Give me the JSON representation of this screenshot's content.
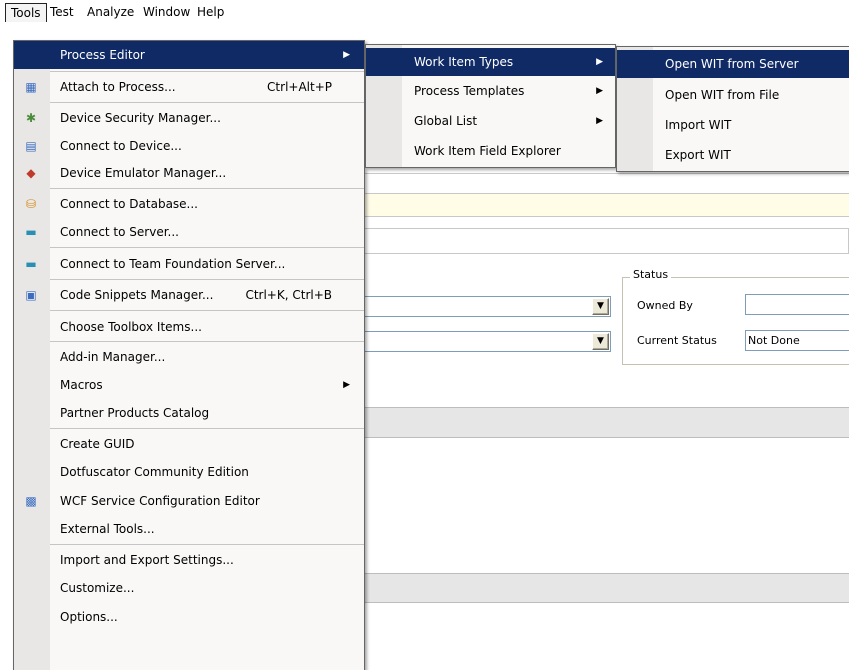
{
  "menubar": {
    "items": [
      {
        "label": "Tools"
      },
      {
        "label": "Test"
      },
      {
        "label": "Analyze"
      },
      {
        "label": "Window"
      },
      {
        "label": "Help"
      }
    ]
  },
  "tools_menu": {
    "items": [
      {
        "label": "Process Editor",
        "shortcut": "",
        "submenu": true,
        "icon": ""
      },
      {
        "label": "Attach to Process...",
        "shortcut": "Ctrl+Alt+P",
        "icon": "attach-process-icon"
      },
      {
        "label": "Device Security Manager...",
        "shortcut": "",
        "icon": "device-security-icon"
      },
      {
        "label": "Connect to Device...",
        "shortcut": "",
        "icon": "connect-device-icon"
      },
      {
        "label": "Device Emulator Manager...",
        "shortcut": "",
        "icon": "emulator-manager-icon"
      },
      {
        "label": "Connect to Database...",
        "shortcut": "",
        "icon": "database-icon"
      },
      {
        "label": "Connect to Server...",
        "shortcut": "",
        "icon": "server-icon"
      },
      {
        "label": "Connect to Team Foundation Server...",
        "shortcut": "",
        "icon": "team-server-icon"
      },
      {
        "label": "Code Snippets Manager...",
        "shortcut": "Ctrl+K, Ctrl+B",
        "icon": "snippets-icon"
      },
      {
        "label": "Choose Toolbox Items...",
        "shortcut": "",
        "icon": ""
      },
      {
        "label": "Add-in Manager...",
        "shortcut": "",
        "icon": ""
      },
      {
        "label": "Macros",
        "shortcut": "",
        "submenu": true,
        "icon": ""
      },
      {
        "label": "Partner Products Catalog",
        "shortcut": "",
        "icon": ""
      },
      {
        "label": "Create GUID",
        "shortcut": "",
        "icon": ""
      },
      {
        "label": "Dotfuscator Community Edition",
        "shortcut": "",
        "icon": ""
      },
      {
        "label": "WCF Service Configuration Editor",
        "shortcut": "",
        "icon": "wcf-config-icon"
      },
      {
        "label": "External Tools...",
        "shortcut": "",
        "icon": ""
      },
      {
        "label": "Import and Export Settings...",
        "shortcut": "",
        "icon": ""
      },
      {
        "label": "Customize...",
        "shortcut": "",
        "icon": ""
      },
      {
        "label": "Options...",
        "shortcut": "",
        "icon": ""
      }
    ]
  },
  "process_editor_menu": {
    "items": [
      {
        "label": "Work Item Types",
        "submenu": true
      },
      {
        "label": "Process Templates",
        "submenu": true
      },
      {
        "label": "Global List",
        "submenu": true
      },
      {
        "label": "Work Item Field Explorer",
        "submenu": false
      }
    ]
  },
  "work_item_types_menu": {
    "items": [
      {
        "label": "Open WIT from Server"
      },
      {
        "label": "Open WIT from File"
      },
      {
        "label": "Import WIT"
      },
      {
        "label": "Export WIT"
      }
    ]
  },
  "status_group": {
    "legend": "Status",
    "owned_by_label": "Owned By",
    "owned_by_value": "",
    "current_status_label": "Current Status",
    "current_status_value": "Not Done"
  },
  "icons": {
    "submenu_arrow": "▶",
    "combo_arrow": "▼"
  },
  "colors": {
    "highlight": "#102a66",
    "menu_bg": "#f9f8f7",
    "gutter": "#e8e7e5"
  }
}
